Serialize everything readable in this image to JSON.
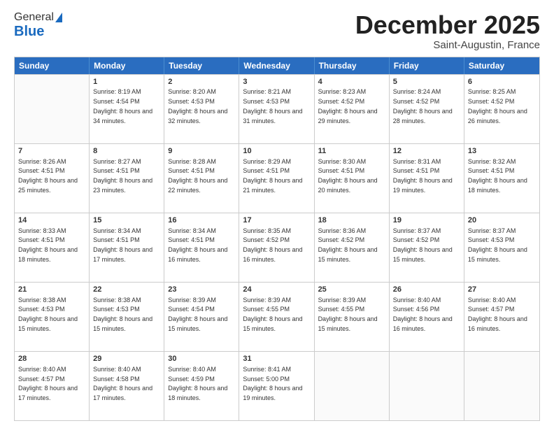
{
  "header": {
    "logo_general": "General",
    "logo_blue": "Blue",
    "title": "December 2025",
    "location": "Saint-Augustin, France"
  },
  "days_of_week": [
    "Sunday",
    "Monday",
    "Tuesday",
    "Wednesday",
    "Thursday",
    "Friday",
    "Saturday"
  ],
  "weeks": [
    [
      {
        "day": "",
        "empty": true
      },
      {
        "day": "1",
        "sunrise": "Sunrise: 8:19 AM",
        "sunset": "Sunset: 4:54 PM",
        "daylight": "Daylight: 8 hours and 34 minutes."
      },
      {
        "day": "2",
        "sunrise": "Sunrise: 8:20 AM",
        "sunset": "Sunset: 4:53 PM",
        "daylight": "Daylight: 8 hours and 32 minutes."
      },
      {
        "day": "3",
        "sunrise": "Sunrise: 8:21 AM",
        "sunset": "Sunset: 4:53 PM",
        "daylight": "Daylight: 8 hours and 31 minutes."
      },
      {
        "day": "4",
        "sunrise": "Sunrise: 8:23 AM",
        "sunset": "Sunset: 4:52 PM",
        "daylight": "Daylight: 8 hours and 29 minutes."
      },
      {
        "day": "5",
        "sunrise": "Sunrise: 8:24 AM",
        "sunset": "Sunset: 4:52 PM",
        "daylight": "Daylight: 8 hours and 28 minutes."
      },
      {
        "day": "6",
        "sunrise": "Sunrise: 8:25 AM",
        "sunset": "Sunset: 4:52 PM",
        "daylight": "Daylight: 8 hours and 26 minutes."
      }
    ],
    [
      {
        "day": "7",
        "sunrise": "Sunrise: 8:26 AM",
        "sunset": "Sunset: 4:51 PM",
        "daylight": "Daylight: 8 hours and 25 minutes."
      },
      {
        "day": "8",
        "sunrise": "Sunrise: 8:27 AM",
        "sunset": "Sunset: 4:51 PM",
        "daylight": "Daylight: 8 hours and 23 minutes."
      },
      {
        "day": "9",
        "sunrise": "Sunrise: 8:28 AM",
        "sunset": "Sunset: 4:51 PM",
        "daylight": "Daylight: 8 hours and 22 minutes."
      },
      {
        "day": "10",
        "sunrise": "Sunrise: 8:29 AM",
        "sunset": "Sunset: 4:51 PM",
        "daylight": "Daylight: 8 hours and 21 minutes."
      },
      {
        "day": "11",
        "sunrise": "Sunrise: 8:30 AM",
        "sunset": "Sunset: 4:51 PM",
        "daylight": "Daylight: 8 hours and 20 minutes."
      },
      {
        "day": "12",
        "sunrise": "Sunrise: 8:31 AM",
        "sunset": "Sunset: 4:51 PM",
        "daylight": "Daylight: 8 hours and 19 minutes."
      },
      {
        "day": "13",
        "sunrise": "Sunrise: 8:32 AM",
        "sunset": "Sunset: 4:51 PM",
        "daylight": "Daylight: 8 hours and 18 minutes."
      }
    ],
    [
      {
        "day": "14",
        "sunrise": "Sunrise: 8:33 AM",
        "sunset": "Sunset: 4:51 PM",
        "daylight": "Daylight: 8 hours and 18 minutes."
      },
      {
        "day": "15",
        "sunrise": "Sunrise: 8:34 AM",
        "sunset": "Sunset: 4:51 PM",
        "daylight": "Daylight: 8 hours and 17 minutes."
      },
      {
        "day": "16",
        "sunrise": "Sunrise: 8:34 AM",
        "sunset": "Sunset: 4:51 PM",
        "daylight": "Daylight: 8 hours and 16 minutes."
      },
      {
        "day": "17",
        "sunrise": "Sunrise: 8:35 AM",
        "sunset": "Sunset: 4:52 PM",
        "daylight": "Daylight: 8 hours and 16 minutes."
      },
      {
        "day": "18",
        "sunrise": "Sunrise: 8:36 AM",
        "sunset": "Sunset: 4:52 PM",
        "daylight": "Daylight: 8 hours and 15 minutes."
      },
      {
        "day": "19",
        "sunrise": "Sunrise: 8:37 AM",
        "sunset": "Sunset: 4:52 PM",
        "daylight": "Daylight: 8 hours and 15 minutes."
      },
      {
        "day": "20",
        "sunrise": "Sunrise: 8:37 AM",
        "sunset": "Sunset: 4:53 PM",
        "daylight": "Daylight: 8 hours and 15 minutes."
      }
    ],
    [
      {
        "day": "21",
        "sunrise": "Sunrise: 8:38 AM",
        "sunset": "Sunset: 4:53 PM",
        "daylight": "Daylight: 8 hours and 15 minutes."
      },
      {
        "day": "22",
        "sunrise": "Sunrise: 8:38 AM",
        "sunset": "Sunset: 4:53 PM",
        "daylight": "Daylight: 8 hours and 15 minutes."
      },
      {
        "day": "23",
        "sunrise": "Sunrise: 8:39 AM",
        "sunset": "Sunset: 4:54 PM",
        "daylight": "Daylight: 8 hours and 15 minutes."
      },
      {
        "day": "24",
        "sunrise": "Sunrise: 8:39 AM",
        "sunset": "Sunset: 4:55 PM",
        "daylight": "Daylight: 8 hours and 15 minutes."
      },
      {
        "day": "25",
        "sunrise": "Sunrise: 8:39 AM",
        "sunset": "Sunset: 4:55 PM",
        "daylight": "Daylight: 8 hours and 15 minutes."
      },
      {
        "day": "26",
        "sunrise": "Sunrise: 8:40 AM",
        "sunset": "Sunset: 4:56 PM",
        "daylight": "Daylight: 8 hours and 16 minutes."
      },
      {
        "day": "27",
        "sunrise": "Sunrise: 8:40 AM",
        "sunset": "Sunset: 4:57 PM",
        "daylight": "Daylight: 8 hours and 16 minutes."
      }
    ],
    [
      {
        "day": "28",
        "sunrise": "Sunrise: 8:40 AM",
        "sunset": "Sunset: 4:57 PM",
        "daylight": "Daylight: 8 hours and 17 minutes."
      },
      {
        "day": "29",
        "sunrise": "Sunrise: 8:40 AM",
        "sunset": "Sunset: 4:58 PM",
        "daylight": "Daylight: 8 hours and 17 minutes."
      },
      {
        "day": "30",
        "sunrise": "Sunrise: 8:40 AM",
        "sunset": "Sunset: 4:59 PM",
        "daylight": "Daylight: 8 hours and 18 minutes."
      },
      {
        "day": "31",
        "sunrise": "Sunrise: 8:41 AM",
        "sunset": "Sunset: 5:00 PM",
        "daylight": "Daylight: 8 hours and 19 minutes."
      },
      {
        "day": "",
        "empty": true
      },
      {
        "day": "",
        "empty": true
      },
      {
        "day": "",
        "empty": true
      }
    ]
  ]
}
